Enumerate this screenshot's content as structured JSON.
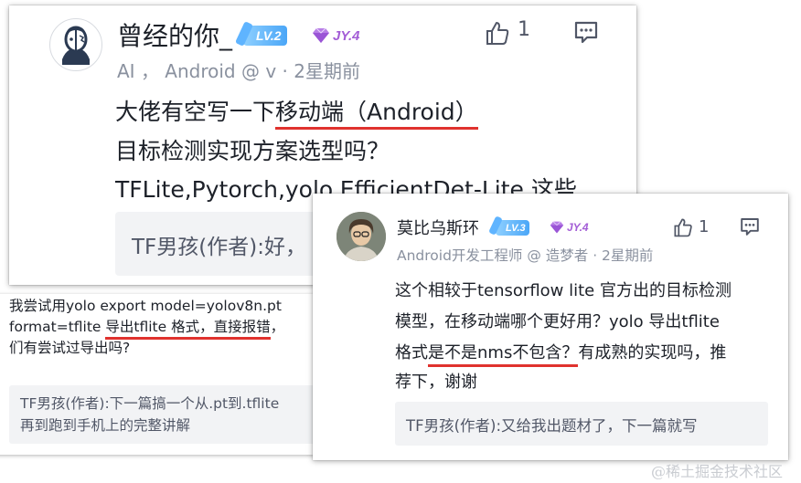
{
  "comment1": {
    "username": "曾经的你_",
    "level": "LV.2",
    "jy": "JY.4",
    "likes": "1",
    "meta": "AI ， Android @ v · 2星期前",
    "line1_a": "大佬有空写一下",
    "line1_b": "移动端（Android）",
    "line2": "目标检测实现方案选型吗？",
    "line3": "TFLite,Pytorch,yolo.EfficientDet-Lite 这些",
    "reply": "TF男孩(作者):好，"
  },
  "comment2": {
    "line1": "我尝试用yolo export model=yolov8n.pt",
    "line2_a": "format=tflite ",
    "line2_b": "导出tflite 格式，直接报错",
    "line2_c": "，",
    "line3": "们有尝试过导出吗?",
    "reply_line1": "TF男孩(作者):下一篇搞一个从.pt到.tflite",
    "reply_line2": "再到跑到手机上的完整讲解"
  },
  "comment3": {
    "username": "莫比乌斯环",
    "level": "LV.3",
    "jy": "JY.4",
    "likes": "1",
    "meta": "Android开发工程师 @ 造梦者 · 2星期前",
    "line1": "这个相较于tensorflow lite 官方出的目标检测",
    "line2": "模型，在移动端哪个更好用？yolo 导出tflite",
    "line3_a": "格式",
    "line3_b": "是不是nms不包含？",
    "line3_c": "有成熟的实现吗，推",
    "line4": "荐下，谢谢",
    "reply": "TF男孩(作者):又给我出题材了，下一篇就写"
  },
  "watermark": "@稀土掘金技术社区",
  "colors": {
    "underline": "#e0322e",
    "level_blue": "#4aa6f7",
    "jy_purple": "#a35dd6",
    "meta_gray": "#8a919f",
    "reply_bg": "#f2f3f5"
  },
  "icons": [
    "like-thumb-icon",
    "comment-bubble-icon"
  ]
}
